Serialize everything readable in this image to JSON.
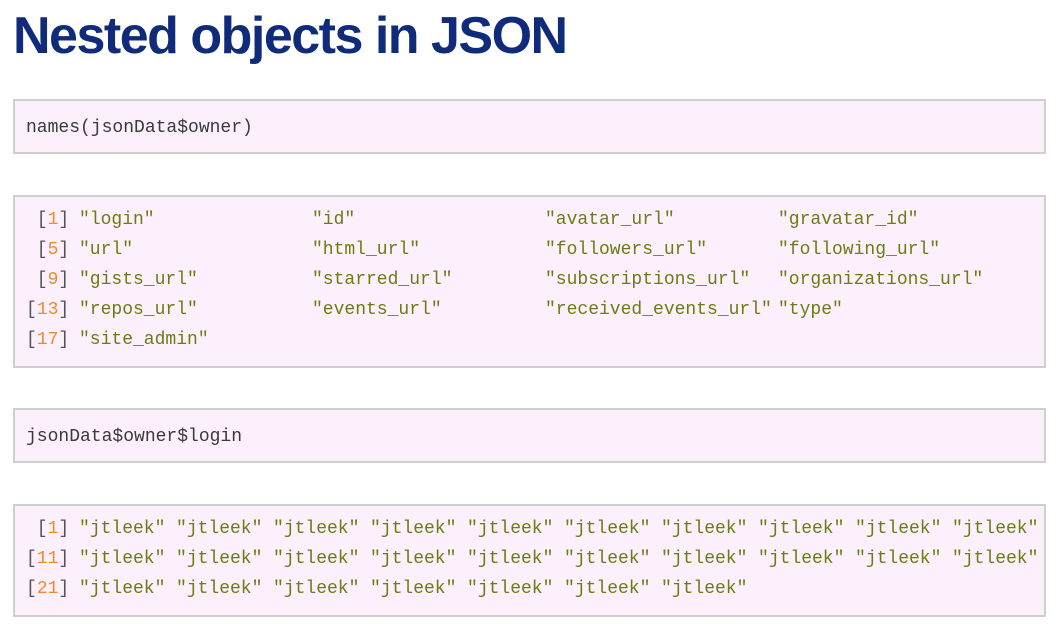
{
  "title": "Nested objects in JSON",
  "code_block_1": {
    "code": "names(jsonData$owner)"
  },
  "output_block_1": {
    "rows": [
      {
        "index": "1",
        "items": [
          "\"login\"",
          "\"id\"",
          "\"avatar_url\"",
          "\"gravatar_id\""
        ]
      },
      {
        "index": "5",
        "items": [
          "\"url\"",
          "\"html_url\"",
          "\"followers_url\"",
          "\"following_url\""
        ]
      },
      {
        "index": "9",
        "items": [
          "\"gists_url\"",
          "\"starred_url\"",
          "\"subscriptions_url\"",
          "\"organizations_url\""
        ]
      },
      {
        "index": "13",
        "items": [
          "\"repos_url\"",
          "\"events_url\"",
          "\"received_events_url\"",
          "\"type\""
        ]
      },
      {
        "index": "17",
        "items": [
          "\"site_admin\""
        ]
      }
    ]
  },
  "code_block_2": {
    "code": "jsonData$owner$login"
  },
  "output_block_2": {
    "rows": [
      {
        "index": "1",
        "items": [
          "\"jtleek\"",
          "\"jtleek\"",
          "\"jtleek\"",
          "\"jtleek\"",
          "\"jtleek\"",
          "\"jtleek\"",
          "\"jtleek\"",
          "\"jtleek\"",
          "\"jtleek\"",
          "\"jtleek\""
        ]
      },
      {
        "index": "11",
        "items": [
          "\"jtleek\"",
          "\"jtleek\"",
          "\"jtleek\"",
          "\"jtleek\"",
          "\"jtleek\"",
          "\"jtleek\"",
          "\"jtleek\"",
          "\"jtleek\"",
          "\"jtleek\"",
          "\"jtleek\""
        ]
      },
      {
        "index": "21",
        "items": [
          "\"jtleek\"",
          "\"jtleek\"",
          "\"jtleek\"",
          "\"jtleek\"",
          "\"jtleek\"",
          "\"jtleek\"",
          "\"jtleek\""
        ]
      }
    ]
  }
}
